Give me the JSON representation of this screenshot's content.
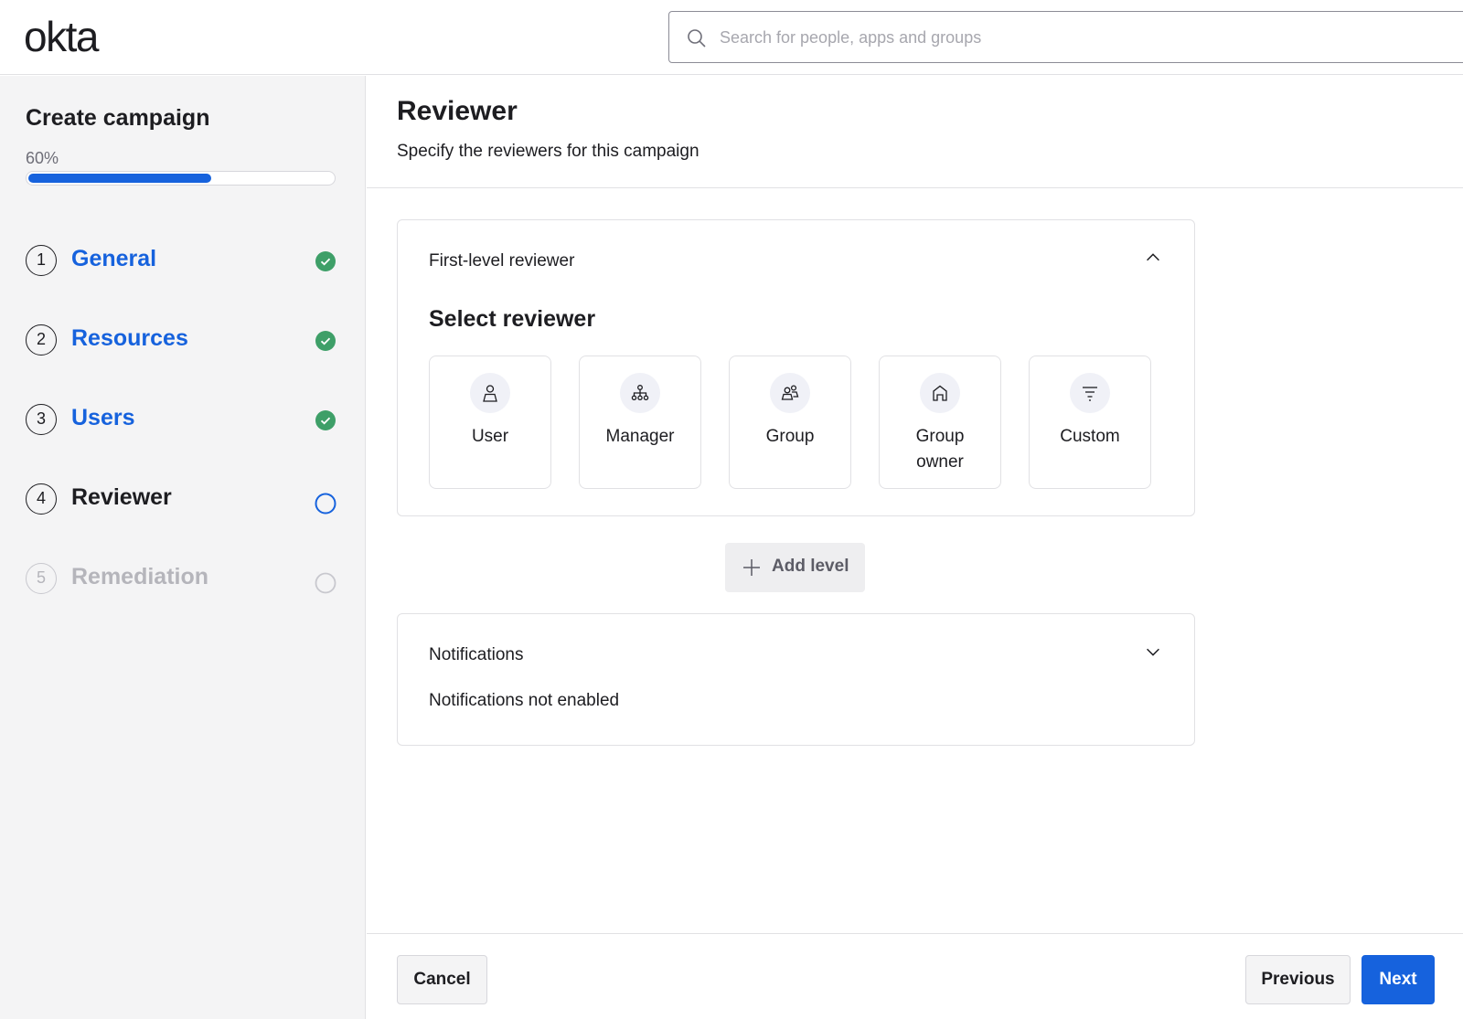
{
  "header": {
    "logo_text": "okta",
    "search_placeholder": "Search for people, apps and groups"
  },
  "sidebar": {
    "title": "Create campaign",
    "progress_label": "60%",
    "progress_fraction": 0.6,
    "steps": [
      {
        "number": "1",
        "label": "General",
        "status": "complete"
      },
      {
        "number": "2",
        "label": "Resources",
        "status": "complete"
      },
      {
        "number": "3",
        "label": "Users",
        "status": "complete"
      },
      {
        "number": "4",
        "label": "Reviewer",
        "status": "current"
      },
      {
        "number": "5",
        "label": "Remediation",
        "status": "upcoming"
      }
    ]
  },
  "main": {
    "title": "Reviewer",
    "subtitle": "Specify the reviewers for this campaign",
    "first_level": {
      "heading": "First-level reviewer",
      "select_title": "Select reviewer",
      "options": [
        {
          "label": "User",
          "icon": "user-icon"
        },
        {
          "label": "Manager",
          "icon": "org-chart-icon"
        },
        {
          "label": "Group",
          "icon": "group-icon"
        },
        {
          "label": "Group owner",
          "icon": "home-icon"
        },
        {
          "label": "Custom",
          "icon": "filter-icon"
        }
      ]
    },
    "add_level_label": "Add level",
    "notifications": {
      "heading": "Notifications",
      "status_text": "Notifications not enabled"
    }
  },
  "footer": {
    "cancel_label": "Cancel",
    "previous_label": "Previous",
    "next_label": "Next"
  },
  "colors": {
    "accent": "#1662dd",
    "success": "#3e9f68",
    "sidebar_bg": "#f4f4f5"
  }
}
